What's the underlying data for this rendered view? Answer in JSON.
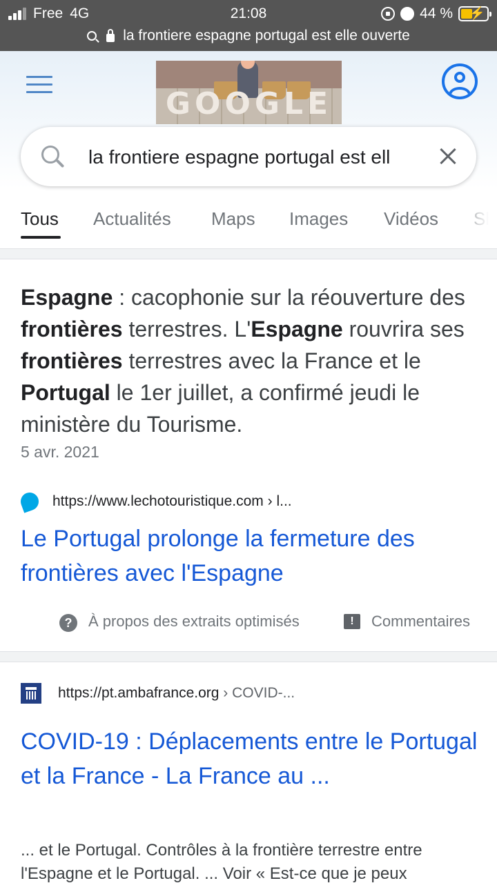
{
  "status_bar": {
    "carrier": "Free",
    "network": "4G",
    "time": "21:08",
    "battery_percent": "44 %",
    "battery_level": 0.44,
    "battery_color": "#f5c000"
  },
  "url_bar": {
    "address": "la frontiere espagne portugal est elle ouverte",
    "icons": [
      "search-icon",
      "lock-icon"
    ]
  },
  "header": {
    "menu_icon": "hamburger-menu-icon",
    "doodle_text": "GOOGLE",
    "account_icon": "account-circle-icon"
  },
  "search": {
    "query": "la frontiere espagne portugal est ell",
    "search_icon": "search-icon",
    "clear_icon": "close-icon"
  },
  "tabs": [
    {
      "label": "Tous",
      "active": true
    },
    {
      "label": "Actualités",
      "active": false
    },
    {
      "label": "Maps",
      "active": false
    },
    {
      "label": "Images",
      "active": false
    },
    {
      "label": "Vidéos",
      "active": false
    },
    {
      "label": "Sh",
      "active": false
    }
  ],
  "featured_snippet": {
    "segments": [
      {
        "text": "Espagne",
        "bold": true
      },
      {
        "text": " : cacophonie sur la réouverture des ",
        "bold": false
      },
      {
        "text": "frontières",
        "bold": true
      },
      {
        "text": " terrestres. L'",
        "bold": false
      },
      {
        "text": "Espagne",
        "bold": true
      },
      {
        "text": " rouvrira ses ",
        "bold": false
      },
      {
        "text": "frontières",
        "bold": true
      },
      {
        "text": " terrestres avec la France et le ",
        "bold": false
      },
      {
        "text": "Portugal",
        "bold": true
      },
      {
        "text": " le 1er juillet, a confirmé jeudi le ministère du Tourisme.",
        "bold": false
      }
    ],
    "date": "5 avr. 2021",
    "source_url": "https://www.lechotouristique.com",
    "source_crumb": " › l...",
    "favicon_color": "#00a7e6",
    "title": "Le Portugal prolonge la fermeture des frontières avec l'Espagne",
    "about_label": "À propos des extraits optimisés",
    "feedback_label": "Commentaires",
    "help_icon_glyph": "?",
    "feedback_icon_glyph": "!"
  },
  "result_2": {
    "source_url": "https://pt.ambafrance.org",
    "source_crumb": " › COVID-...",
    "favicon_color": "#233f84",
    "title": "COVID-19 : Déplacements entre le Portugal et la France - La France au ...",
    "description": "... et le Portugal. Contrôles à la frontière terrestre entre l'Espagne et le Portugal. ... Voir « Est-ce que je peux"
  },
  "colors": {
    "link": "#1558d6",
    "accent": "#1a73e8",
    "status_bar_bg": "#555555"
  }
}
